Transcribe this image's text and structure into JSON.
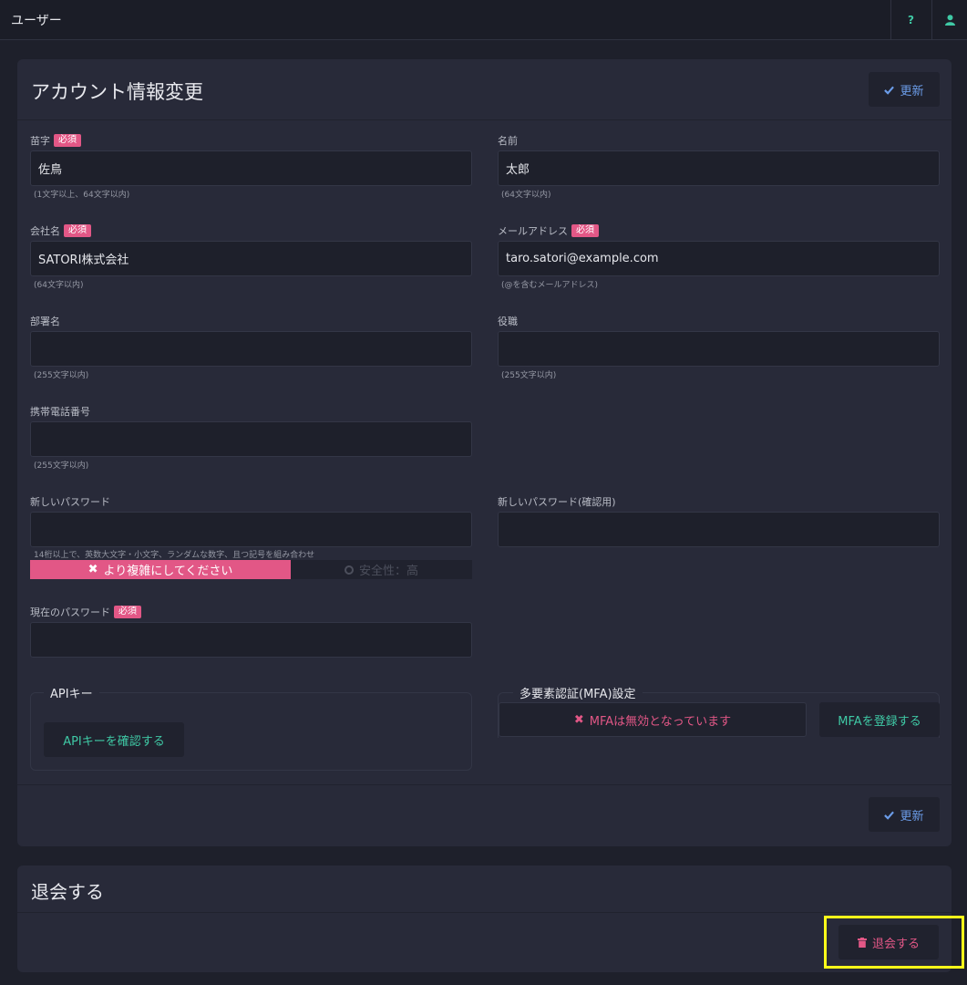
{
  "topbar": {
    "title": "ユーザー",
    "help_glyph": "?",
    "user_icon": "user-icon"
  },
  "account": {
    "title": "アカウント情報変更",
    "update_label": "更新",
    "required_badge": "必須",
    "last_name": {
      "label": "苗字",
      "value": "佐鳥",
      "hint": "(1文字以上、64文字以内)"
    },
    "first_name": {
      "label": "名前",
      "value": "太郎",
      "hint": "(64文字以内)"
    },
    "company": {
      "label": "会社名",
      "value": "SATORI株式会社",
      "hint": "(64文字以内)"
    },
    "email": {
      "label": "メールアドレス",
      "value": "taro.satori@example.com",
      "hint": "(@を含むメールアドレス)"
    },
    "department": {
      "label": "部署名",
      "value": "",
      "hint": "(255文字以内)"
    },
    "position": {
      "label": "役職",
      "value": "",
      "hint": "(255文字以内)"
    },
    "mobile": {
      "label": "携帯電話番号",
      "value": "",
      "hint": "(255文字以内)"
    },
    "new_password": {
      "label": "新しいパスワード",
      "value": "",
      "hint": "14桁以上で、英数大文字・小文字、ランダムな数字、且つ記号を組み合わせ"
    },
    "new_password_confirm": {
      "label": "新しいパスワード(確認用)",
      "value": ""
    },
    "strength": {
      "weak_text": "より複雑にしてください",
      "high_text": "安全性：高"
    },
    "current_password": {
      "label": "現在のパスワード",
      "value": ""
    },
    "api_key": {
      "legend": "APIキー",
      "button": "APIキーを確認する"
    },
    "mfa": {
      "legend": "多要素認証(MFA)設定",
      "status": "MFAは無効となっています",
      "register_button": "MFAを登録する"
    }
  },
  "withdraw": {
    "title": "退会する",
    "button": "退会する"
  },
  "colors": {
    "accent_green": "#3fc9a5",
    "accent_pink": "#e25786",
    "accent_blue": "#6b9ce8",
    "highlight": "#ffff1a"
  }
}
